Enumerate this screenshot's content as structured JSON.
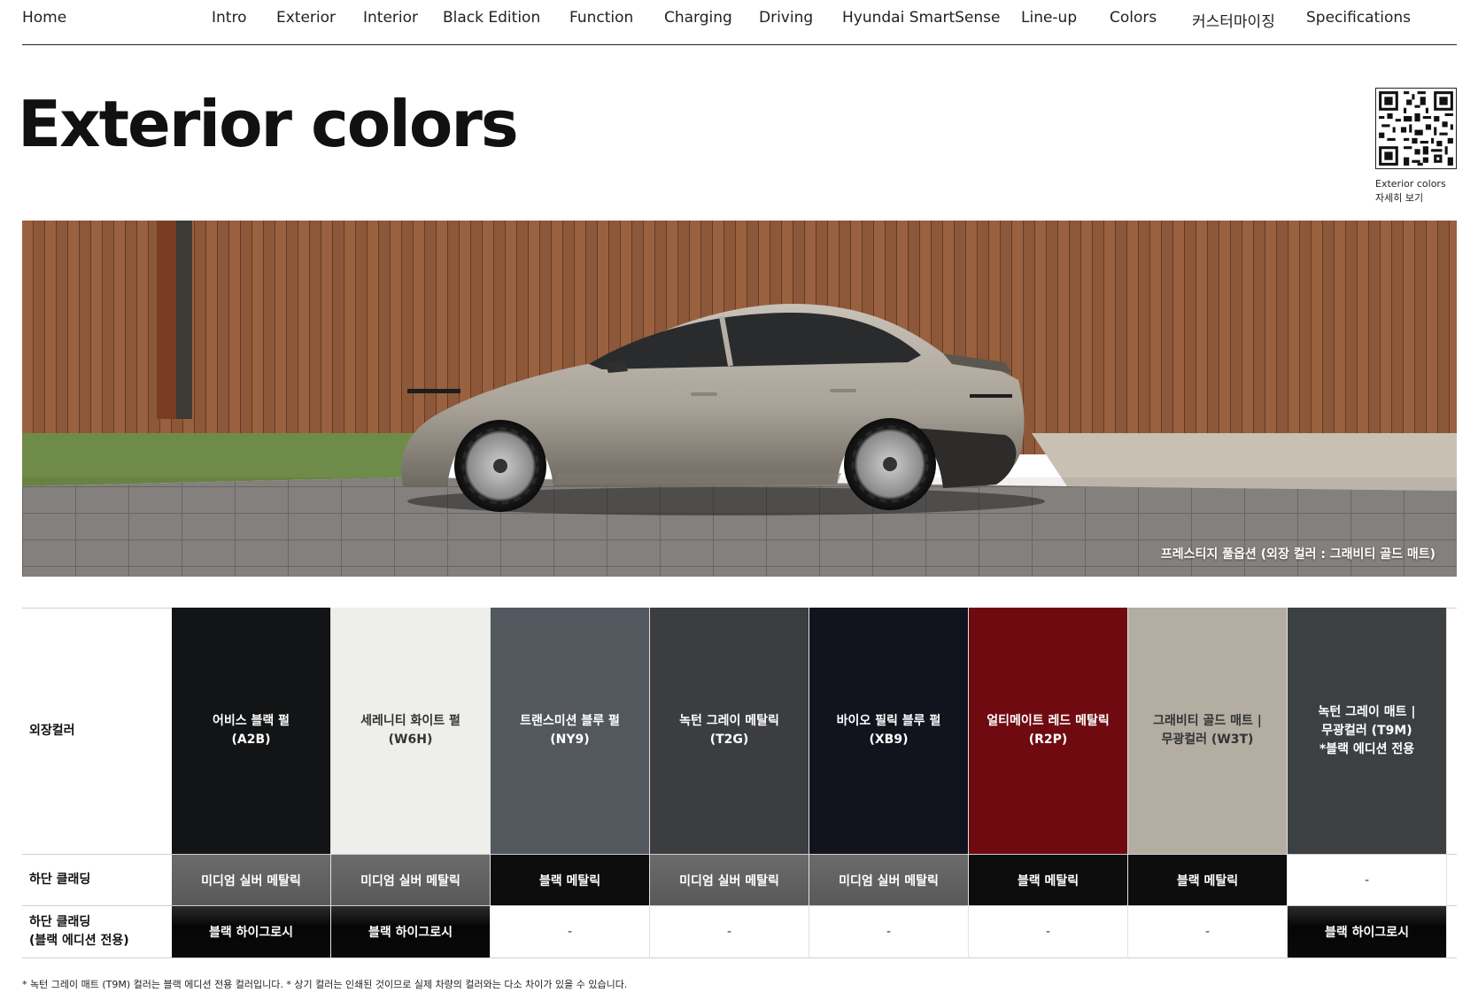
{
  "nav": {
    "home": "Home",
    "items": [
      "Intro",
      "Exterior",
      "Interior",
      "Black Edition",
      "Function",
      "Charging",
      "Driving",
      "Hyundai SmartSense",
      "Line-up",
      "Colors",
      "커스터마이징",
      "Specifications"
    ]
  },
  "page_title": "Exterior colors",
  "qr": {
    "caption_line1": "Exterior colors",
    "caption_line2": "자세히 보기"
  },
  "hero": {
    "caption": "프레스티지 풀옵션 (외장 컬러 : 그래비티 골드 매트)"
  },
  "table": {
    "row_labels": {
      "exterior": "외장컬러",
      "lower_cladding": "하단 클래딩",
      "lower_cladding_black_line1": "하단 클래딩",
      "lower_cladding_black_line2": "(블랙 에디션 전용)"
    },
    "colors": [
      {
        "name": "어비스 블랙 펄",
        "code": "(A2B)",
        "extra": "",
        "swatch": "#131416",
        "text": "#ffffff",
        "cladding": "미디엄 실버 메탈릭",
        "cladding_style": "silver",
        "black_edition": "블랙 하이그로시",
        "black_edition_style": "gloss"
      },
      {
        "name": "세레니티 화이트 펄",
        "code": "(W6H)",
        "extra": "",
        "swatch": "#eeeeea",
        "text": "#333333",
        "cladding": "미디엄 실버 메탈릭",
        "cladding_style": "silver",
        "black_edition": "블랙 하이그로시",
        "black_edition_style": "gloss"
      },
      {
        "name": "트랜스미션 블루 펄",
        "code": "(NY9)",
        "extra": "",
        "swatch": "#53575e",
        "text": "#ffffff",
        "cladding": "블랙 메탈릭",
        "cladding_style": "black",
        "black_edition": "-",
        "black_edition_style": "none"
      },
      {
        "name": "녹턴 그레이 메탈릭",
        "code": "(T2G)",
        "extra": "",
        "swatch": "#3b3d41",
        "text": "#ffffff",
        "cladding": "미디엄 실버 메탈릭",
        "cladding_style": "silver",
        "black_edition": "-",
        "black_edition_style": "none"
      },
      {
        "name": "바이오 필릭 블루 펄",
        "code": "(XB9)",
        "extra": "",
        "swatch": "#11131d",
        "text": "#ffffff",
        "cladding": "미디엄 실버 메탈릭",
        "cladding_style": "silver",
        "black_edition": "-",
        "black_edition_style": "none"
      },
      {
        "name": "얼티메이트 레드 메탈릭",
        "code": "(R2P)",
        "extra": "",
        "swatch": "#6e0a10",
        "text": "#ffffff",
        "cladding": "블랙 메탈릭",
        "cladding_style": "black",
        "black_edition": "-",
        "black_edition_style": "none"
      },
      {
        "name": "그래비티 골드 매트 |",
        "code": "무광컬러 (W3T)",
        "extra": "",
        "swatch": "#b3ada2",
        "text": "#333333",
        "cladding": "블랙 메탈릭",
        "cladding_style": "black",
        "black_edition": "-",
        "black_edition_style": "none"
      },
      {
        "name": "녹턴 그레이 매트 |",
        "code": "무광컬러 (T9M)",
        "extra": "*블랙 에디션 전용",
        "swatch": "#3c4043",
        "text": "#ffffff",
        "cladding": "-",
        "cladding_style": "none",
        "black_edition": "블랙 하이그로시",
        "black_edition_style": "gloss"
      }
    ]
  },
  "footnote": "* 녹턴 그레이 매트 (T9M) 컬러는 블랙 에디션 전용 컬러입니다.  * 상기 컬러는 인쇄된 것이므로 실제 차량의 컬러와는 다소 차이가 있을 수 있습니다."
}
